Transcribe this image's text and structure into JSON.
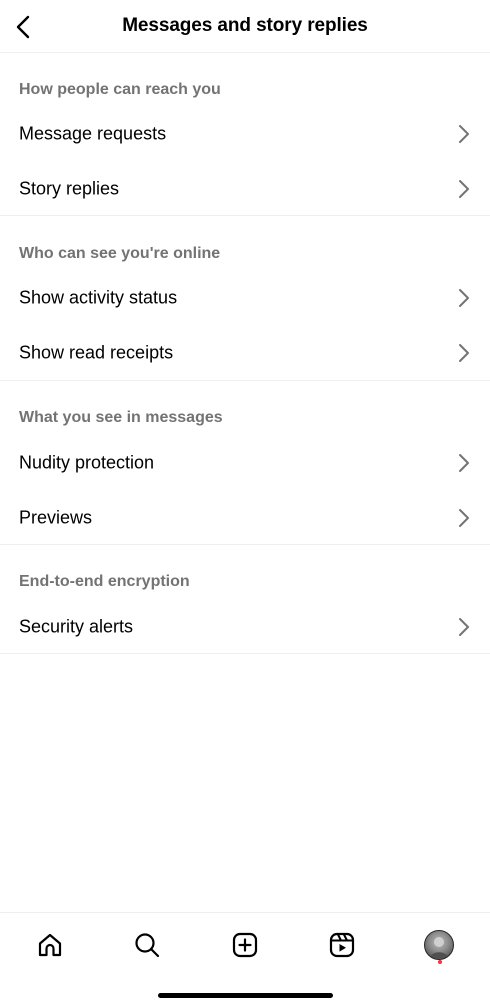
{
  "header": {
    "title": "Messages and story replies",
    "back_icon": "chevron-left-icon"
  },
  "sections": [
    {
      "heading": "How people can reach you",
      "items": [
        {
          "label": "Message requests"
        },
        {
          "label": "Story replies"
        }
      ]
    },
    {
      "heading": "Who can see you're online",
      "items": [
        {
          "label": "Show activity status"
        },
        {
          "label": "Show read receipts"
        }
      ]
    },
    {
      "heading": "What you see in messages",
      "items": [
        {
          "label": "Nudity protection"
        },
        {
          "label": "Previews"
        }
      ]
    },
    {
      "heading": "End-to-end encryption",
      "items": [
        {
          "label": "Security alerts"
        }
      ]
    }
  ],
  "tabbar": {
    "tabs": [
      "home-icon",
      "search-icon",
      "create-icon",
      "reels-icon",
      "profile-avatar"
    ],
    "profile_has_notification": true
  },
  "colors": {
    "heading_gray": "#737373",
    "divider": "#efefef",
    "chevron": "#737373",
    "notification_dot": "#ff3040"
  }
}
